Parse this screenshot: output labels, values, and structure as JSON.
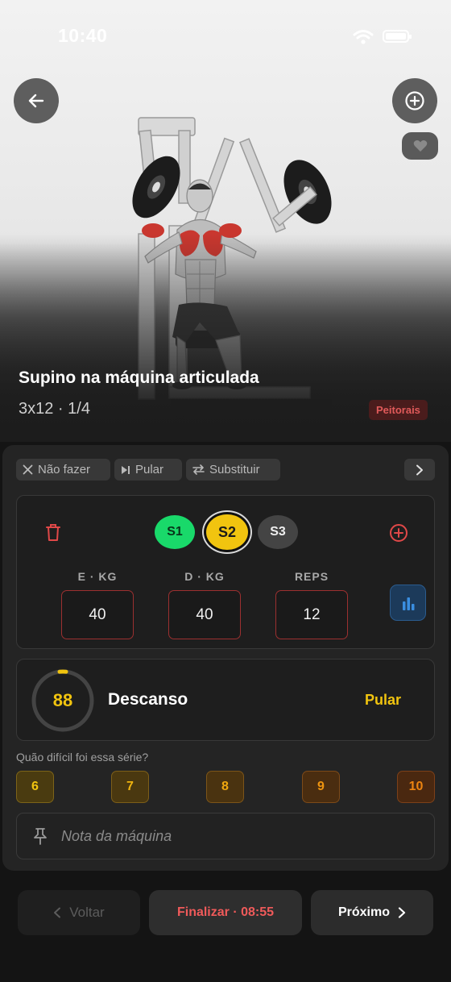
{
  "status_bar": {
    "time": "10:40"
  },
  "exercise": {
    "title": "Supino na máquina articulada",
    "subtitle": "3x12 · 1/4",
    "muscle": "Peitorais"
  },
  "actions": {
    "skip_do": "Não fazer",
    "skip": "Pular",
    "substitute": "Substituir"
  },
  "sets": {
    "items": [
      "S1",
      "S2",
      "S3"
    ],
    "active": "S2",
    "labels": {
      "e_kg": "E · KG",
      "d_kg": "D · KG",
      "reps": "REPS"
    },
    "values": {
      "e_kg": "40",
      "d_kg": "40",
      "reps": "12"
    }
  },
  "rest": {
    "seconds": "88",
    "label": "Descanso",
    "skip_label": "Pular"
  },
  "rpe": {
    "question": "Quão difícil foi essa série?",
    "options": [
      "6",
      "7",
      "8",
      "9",
      "10"
    ]
  },
  "note": {
    "placeholder": "Nota da máquina"
  },
  "footer": {
    "back": "Voltar",
    "finish": "Finalizar · 08:55",
    "next": "Próximo"
  },
  "colors": {
    "accent_yellow": "#f1c40f",
    "set_done_green": "#19d96a",
    "danger_red": "#ef5a5a",
    "muscle_red": "#c9372f"
  }
}
